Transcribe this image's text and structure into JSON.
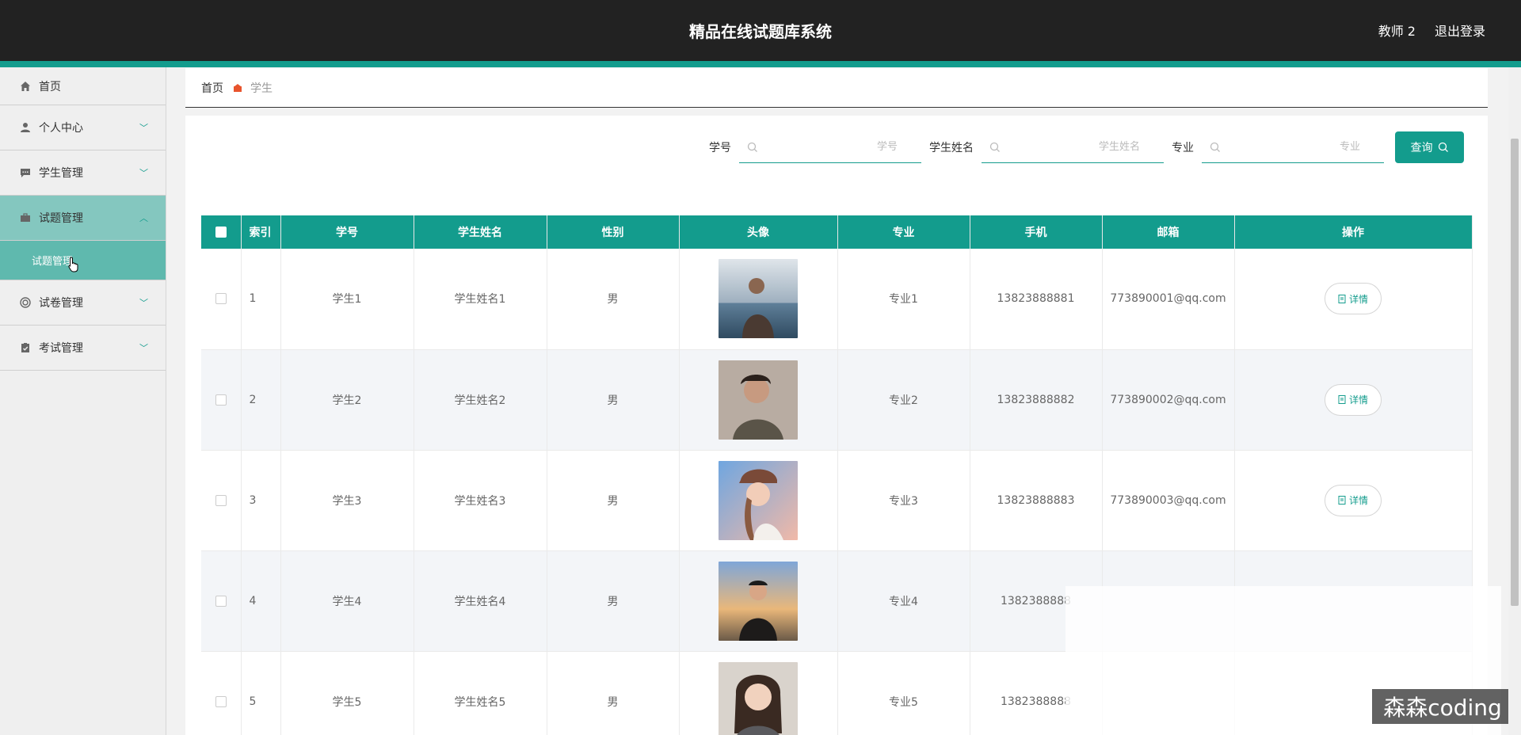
{
  "header": {
    "title": "精品在线试题库系统",
    "user": "教师 2",
    "logout": "退出登录",
    "bar_color": "#222222",
    "accent": "#139c8d"
  },
  "sidebar": {
    "items": [
      {
        "label": "首页",
        "icon": "home-icon"
      },
      {
        "label": "个人中心",
        "icon": "user-icon"
      },
      {
        "label": "学生管理",
        "icon": "chat-icon"
      },
      {
        "label": "试题管理",
        "icon": "briefcase-icon",
        "expanded": true,
        "sub": [
          {
            "label": "试题管理"
          }
        ]
      },
      {
        "label": "试卷管理",
        "icon": "circle-icon"
      },
      {
        "label": "考试管理",
        "icon": "clipboard-icon"
      }
    ]
  },
  "breadcrumb": {
    "home": "首页",
    "current": "学生"
  },
  "search": {
    "fields": [
      {
        "label": "学号",
        "placeholder": "学号"
      },
      {
        "label": "学生姓名",
        "placeholder": "学生姓名"
      },
      {
        "label": "专业",
        "placeholder": "专业"
      }
    ],
    "button": "查询"
  },
  "table": {
    "headers": [
      "索引",
      "学号",
      "学生姓名",
      "性别",
      "头像",
      "专业",
      "手机",
      "邮箱",
      "操作"
    ],
    "rows": [
      {
        "index": "1",
        "id": "学生1",
        "name": "学生姓名1",
        "gender": "男",
        "major": "专业1",
        "phone": "13823888881",
        "email": "773890001@qq.com",
        "action": "详情"
      },
      {
        "index": "2",
        "id": "学生2",
        "name": "学生姓名2",
        "gender": "男",
        "major": "专业2",
        "phone": "13823888882",
        "email": "773890002@qq.com",
        "action": "详情"
      },
      {
        "index": "3",
        "id": "学生3",
        "name": "学生姓名3",
        "gender": "男",
        "major": "专业3",
        "phone": "13823888883",
        "email": "773890003@qq.com",
        "action": "详情"
      },
      {
        "index": "4",
        "id": "学生4",
        "name": "学生姓名4",
        "gender": "男",
        "major": "专业4",
        "phone": "1382388888",
        "email": "",
        "action": ""
      },
      {
        "index": "5",
        "id": "学生5",
        "name": "学生姓名5",
        "gender": "男",
        "major": "专业5",
        "phone": "1382388888",
        "email": "",
        "action": ""
      }
    ]
  },
  "watermark": "森森coding"
}
